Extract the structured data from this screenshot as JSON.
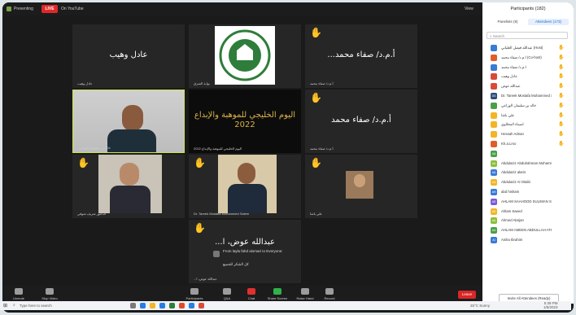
{
  "topbar": {
    "speaker_view": "Presenting",
    "live_label": "LIVE",
    "view_label": "On YouTube",
    "gallery_label": "View"
  },
  "tiles": [
    {
      "name": "عادل وهيب",
      "big": "عادل وهيب",
      "hand": false
    },
    {
      "name": "بوابة الشرق",
      "big": "",
      "hand": false
    },
    {
      "name": "أ.م.د/ صفاء محمد",
      "big": "...أ.م.د/ صفاء محمد",
      "hand": true
    },
    {
      "name": "خالد بن سليمان الوزاعي",
      "big": "",
      "hand": false
    },
    {
      "name": "اليوم الخليجي للموهبة والإبداع 2022",
      "big": "اليوم الخليجي للموهبة والإبداع 2022",
      "hand": false
    },
    {
      "name": "أ.م.د/ صفاء محمد",
      "big": "أ.م.د/ صفاء محمد",
      "hand": true
    },
    {
      "name": "الدكتور شريف شوقي",
      "big": "",
      "hand": true
    },
    {
      "name": "Dr. Tareek Mostafa Mohammed Salem",
      "big": "",
      "hand": true
    },
    {
      "name": "علي باشا",
      "big": "",
      "hand": true
    },
    {
      "name": "...عبدالله عوض، ا",
      "big": "...عبدالله عوض، ا",
      "hand": true
    }
  ],
  "chat_toast": {
    "from": "From layla fahd alomari to Everyone:",
    "msg": "كل الشكر للجميع"
  },
  "bottom": {
    "mute": "Unmute",
    "video": "Stop Video",
    "participants": "Participants",
    "qa": "Q&A",
    "chat": "Chat",
    "share": "Share Screen",
    "raise": "Raise Hand",
    "record": "Record",
    "leave": "Leave"
  },
  "panel": {
    "title": "Participants (182)",
    "tab_panelists": "Panelists (9)",
    "tab_attendees": "Attendees (173)",
    "search_placeholder": "Search",
    "invite": "Invite All Attendees (Ready)"
  },
  "participants": [
    {
      "initials": "",
      "name": "عبدالله فيصل العلياني (Host)",
      "color": "#3a7bd5",
      "hand": true
    },
    {
      "initials": "",
      "name": "أ.م.د/ صفاء محمد (Co-host)",
      "color": "#e05c2c",
      "hand": true
    },
    {
      "initials": "",
      "name": "أ.م.د/ صفاء محمد",
      "color": "#3a7bd5",
      "hand": true
    },
    {
      "initials": "",
      "name": "عادل وهيب",
      "color": "#d94a3a",
      "hand": true
    },
    {
      "initials": "",
      "name": "عبدالله عوض",
      "color": "#d94a3a",
      "hand": true
    },
    {
      "initials": "DS",
      "name": "Dr. Tareek Mostafa Mohammed Salem",
      "color": "#2e4b7a",
      "hand": true
    },
    {
      "initials": "",
      "name": "خالد بن سليمان الوزاعي",
      "color": "#4aa04a",
      "hand": true
    },
    {
      "initials": "",
      "name": "علي باشا",
      "color": "#f2b527",
      "hand": true
    },
    {
      "initials": "",
      "name": "أسماء المحلاوي",
      "color": "#f2b527",
      "hand": true
    },
    {
      "initials": "",
      "name": "Hessah Adnan",
      "color": "#f2b527",
      "hand": true
    },
    {
      "initials": "",
      "name": "Kh.a.Lmo",
      "color": "#e05c2c",
      "hand": true
    },
    {
      "initials": "AA",
      "name": "",
      "color": "#4aa04a",
      "hand": false
    },
    {
      "initials": "AA",
      "name": "Abdulaziz Abdulrahman Mohammed",
      "color": "#8cbf3a",
      "hand": false
    },
    {
      "initials": "AA",
      "name": "Abdulaziz alaris",
      "color": "#3a7bd5",
      "hand": false
    },
    {
      "initials": "AA",
      "name": "Abdulaziz Al Otaibi",
      "color": "#f2b527",
      "hand": false
    },
    {
      "initials": "AH",
      "name": "abd hisham",
      "color": "#3a7bd5",
      "hand": false
    },
    {
      "initials": "AS",
      "name": "AHLAM SAAHOOD SULIMAN SALIMAN",
      "color": "#7a5bd5",
      "hand": false
    },
    {
      "initials": "AS",
      "name": "Ahlam Saeed",
      "color": "#f2b527",
      "hand": false
    },
    {
      "initials": "AA",
      "name": "Ahmed Alarjan",
      "color": "#8cbf3a",
      "hand": false
    },
    {
      "initials": "AA",
      "name": "AHLAM AMEEN ABDULLAH ATHERI",
      "color": "#4aa04a",
      "hand": false
    },
    {
      "initials": "AI",
      "name": "Aisha Ibrahim",
      "color": "#3a7bd5",
      "hand": false
    }
  ],
  "taskbar": {
    "search": "Type here to search",
    "weather": "25°C Sunny",
    "time": "5:39 PM",
    "date": "1/5/2023"
  }
}
